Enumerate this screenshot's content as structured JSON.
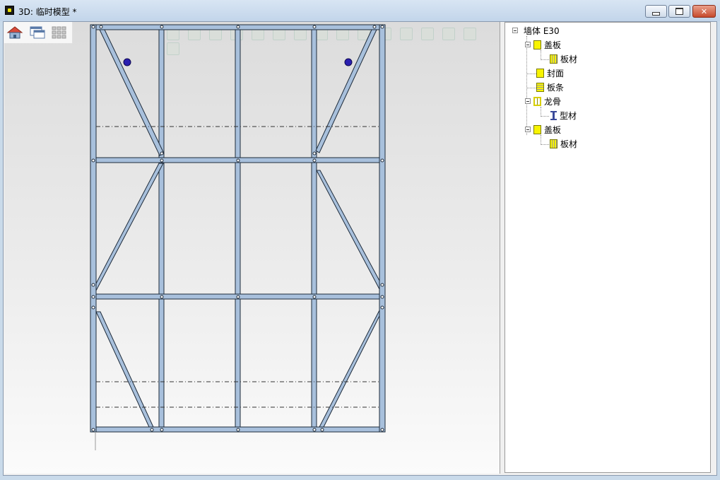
{
  "window": {
    "title": "3D: 临时模型 *",
    "app_icon": "app-3d-icon",
    "buttons": [
      "minimize-icon",
      "maximize-icon",
      "close-icon"
    ],
    "close_glyph": "✕"
  },
  "toolbar": {
    "tools": [
      "home-icon",
      "window-icon",
      "grid-icon"
    ]
  },
  "colors": {
    "member_fill": "#a8c0dc",
    "member_stroke": "#1e2b3a",
    "marker": "#2a1fb0",
    "close_button": "#c74a2c",
    "tree_icon_yellow": "#f8f400"
  },
  "tree": {
    "root": "墙体 E30",
    "nodes": [
      {
        "label": "盖板",
        "icon": "plate-icon"
      },
      {
        "label": "板材",
        "icon": "sheet-icon"
      },
      {
        "label": "封面",
        "icon": "plate-icon"
      },
      {
        "label": "板条",
        "icon": "strip-icon"
      },
      {
        "label": "龙骨",
        "icon": "frame-icon"
      },
      {
        "label": "型材",
        "icon": "ibeam-icon"
      },
      {
        "label": "盖板",
        "icon": "plate-icon"
      },
      {
        "label": "板材",
        "icon": "sheet-icon"
      }
    ]
  }
}
